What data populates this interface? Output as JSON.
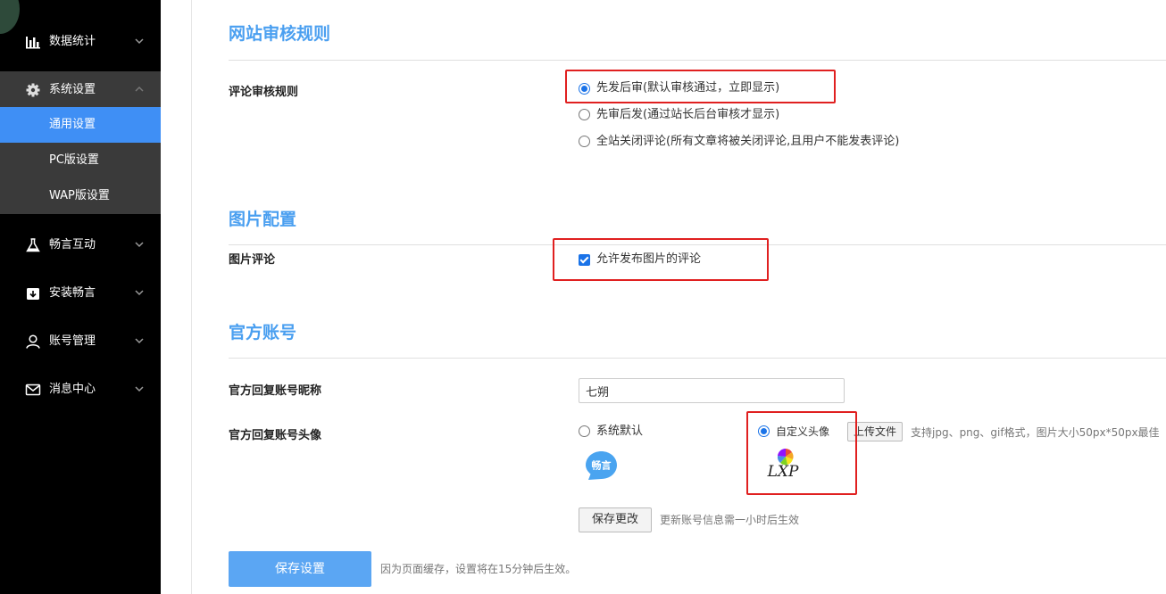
{
  "sidebar": {
    "items": [
      {
        "label": "数据统计",
        "icon": "bar-chart-icon"
      },
      {
        "label": "系统设置",
        "icon": "gear-icon"
      },
      {
        "label": "畅言互动",
        "icon": "flask-icon"
      },
      {
        "label": "安装畅言",
        "icon": "download-box-icon"
      },
      {
        "label": "账号管理",
        "icon": "user-icon"
      },
      {
        "label": "消息中心",
        "icon": "mail-icon"
      }
    ],
    "sub_items": [
      {
        "label": "通用设置",
        "active": true
      },
      {
        "label": "PC版设置",
        "active": false
      },
      {
        "label": "WAP版设置",
        "active": false
      }
    ]
  },
  "review": {
    "title": "网站审核规则",
    "label": "评论审核规则",
    "options": [
      {
        "text": "先发后审(默认审核通过，立即显示)",
        "checked": true
      },
      {
        "text": "先审后发(通过站长后台审核才显示)",
        "checked": false
      },
      {
        "text": "全站关闭评论(所有文章将被关闭评论,且用户不能发表评论)",
        "checked": false
      }
    ]
  },
  "image": {
    "title": "图片配置",
    "label": "图片评论",
    "checkbox_text": "允许发布图片的评论",
    "checked": true
  },
  "official": {
    "title": "官方账号",
    "nickname_label": "官方回复账号昵称",
    "nickname_value": "七朔",
    "avatar_label": "官方回复账号头像",
    "default_option": "系统默认",
    "default_avatar_text": "畅言",
    "custom_option": "自定义头像",
    "upload_button": "上传文件",
    "upload_hint": "支持jpg、png、gif格式，图片大小50px*50px最佳",
    "custom_logo_text": "LXP",
    "save_changes_button": "保存更改",
    "save_changes_hint": "更新账号信息需一小时后生效"
  },
  "footer": {
    "save_button": "保存设置",
    "save_hint": "因为页面缓存，设置将在15分钟后生效。"
  },
  "colors": {
    "accent": "#4a9ff0",
    "active_nav": "#3f8ff5",
    "highlight_box": "#e02020"
  }
}
